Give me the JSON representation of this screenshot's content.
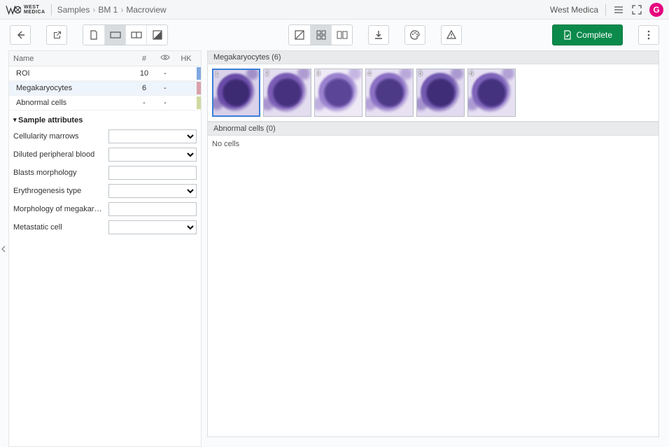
{
  "header": {
    "brand_top": "WEST",
    "brand_bottom": "MEDICA",
    "breadcrumb": [
      "Samples",
      "BM 1",
      "Macroview"
    ],
    "username": "West Medica",
    "avatar_initial": "G"
  },
  "toolbar": {
    "complete_label": "Complete"
  },
  "sidebar": {
    "columns": {
      "name": "Name",
      "count": "#",
      "eye": "👁",
      "hk": "HK"
    },
    "rows": [
      {
        "name": "ROI",
        "count": "10",
        "eye": "-",
        "hk": "",
        "accent": "#7fa9e0"
      },
      {
        "name": "Megakaryocytes",
        "count": "6",
        "eye": "-",
        "hk": "",
        "accent": "#d9a0a9",
        "selected": true
      },
      {
        "name": "Abnormal cells",
        "count": "-",
        "eye": "-",
        "hk": "",
        "accent": "#cfd9a0"
      }
    ],
    "section_title": "Sample attributes",
    "attributes": [
      {
        "label": "Cellularity marrows",
        "type": "select"
      },
      {
        "label": "Diluted peripheral blood",
        "type": "select"
      },
      {
        "label": "Blasts morphology",
        "type": "text"
      },
      {
        "label": "Erythrogenesis type",
        "type": "select"
      },
      {
        "label": "Morphology of megakaryocyt...",
        "type": "text"
      },
      {
        "label": "Metastatic cell",
        "type": "select"
      }
    ]
  },
  "panels": {
    "mega": {
      "title": "Megakaryocytes (6)",
      "thumbs": [
        1,
        2,
        3,
        4,
        5,
        6
      ]
    },
    "abnormal": {
      "title": "Abnormal cells (0)",
      "empty_text": "No cells"
    }
  }
}
